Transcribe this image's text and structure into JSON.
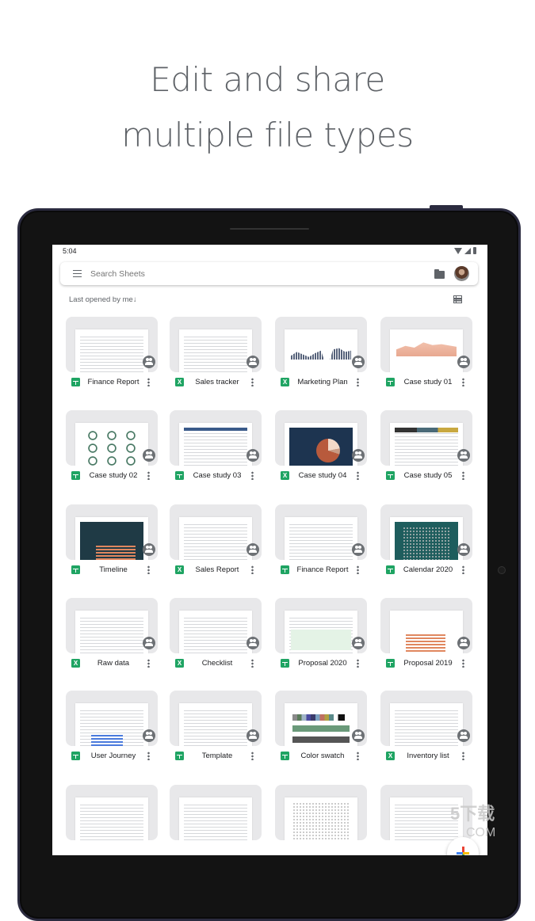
{
  "headline": {
    "line1": "Edit and share",
    "line2": "multiple file types"
  },
  "statusbar": {
    "time": "5:04",
    "icons": [
      "wifi-icon",
      "signal-icon",
      "battery-icon"
    ]
  },
  "searchbar": {
    "placeholder": "Search Sheets",
    "menu_icon": "menu-icon",
    "folder_icon": "folder-icon",
    "avatar_icon": "account-avatar"
  },
  "sortbar": {
    "label": "Last opened by me",
    "arrow": "↓",
    "view_toggle_icon": "list-view-icon"
  },
  "files": [
    {
      "name": "Finance Report",
      "type": "sheets",
      "shared": true,
      "thumb": "lines"
    },
    {
      "name": "Sales tracker",
      "type": "excel",
      "shared": true,
      "thumb": "lines"
    },
    {
      "name": "Marketing Plan",
      "type": "excel",
      "shared": true,
      "thumb": "columns"
    },
    {
      "name": "Case study 01",
      "type": "sheets",
      "shared": true,
      "thumb": "area"
    },
    {
      "name": "Case study 02",
      "type": "sheets",
      "shared": true,
      "thumb": "circles"
    },
    {
      "name": "Case study 03",
      "type": "sheets",
      "shared": true,
      "thumb": "table-blue"
    },
    {
      "name": "Case study 04",
      "type": "excel",
      "shared": true,
      "thumb": "pie"
    },
    {
      "name": "Case study 05",
      "type": "sheets",
      "shared": true,
      "thumb": "gantt"
    },
    {
      "name": "Timeline",
      "type": "sheets",
      "shared": true,
      "thumb": "dark-bars"
    },
    {
      "name": "Sales Report",
      "type": "excel",
      "shared": true,
      "thumb": "lines"
    },
    {
      "name": "Finance Report",
      "type": "sheets",
      "shared": true,
      "thumb": "lines"
    },
    {
      "name": "Calendar 2020",
      "type": "sheets",
      "shared": true,
      "thumb": "teal-calendar"
    },
    {
      "name": "Raw data",
      "type": "excel",
      "shared": true,
      "thumb": "lines"
    },
    {
      "name": "Checklist",
      "type": "excel",
      "shared": true,
      "thumb": "lines"
    },
    {
      "name": "Proposal 2020",
      "type": "sheets",
      "shared": true,
      "thumb": "green-box"
    },
    {
      "name": "Proposal 2019",
      "type": "sheets",
      "shared": true,
      "thumb": "orange-bars"
    },
    {
      "name": "User Journey",
      "type": "sheets",
      "shared": true,
      "thumb": "blue-bars"
    },
    {
      "name": "Template",
      "type": "sheets",
      "shared": true,
      "thumb": "lines"
    },
    {
      "name": "Color swatch",
      "type": "sheets",
      "shared": true,
      "thumb": "swatches"
    },
    {
      "name": "Inventory list",
      "type": "excel",
      "shared": true,
      "thumb": "lines"
    },
    {
      "name": "",
      "type": "",
      "shared": false,
      "thumb": "lines"
    },
    {
      "name": "",
      "type": "",
      "shared": false,
      "thumb": "lines"
    },
    {
      "name": "",
      "type": "",
      "shared": false,
      "thumb": "calendar"
    },
    {
      "name": "",
      "type": "",
      "shared": false,
      "thumb": "lines"
    }
  ],
  "type_icons": {
    "excel": "X",
    "sheets": ""
  },
  "fab": {
    "icon": "plus-icon"
  },
  "watermark": {
    "main": "5下载",
    "sub": "COM"
  }
}
